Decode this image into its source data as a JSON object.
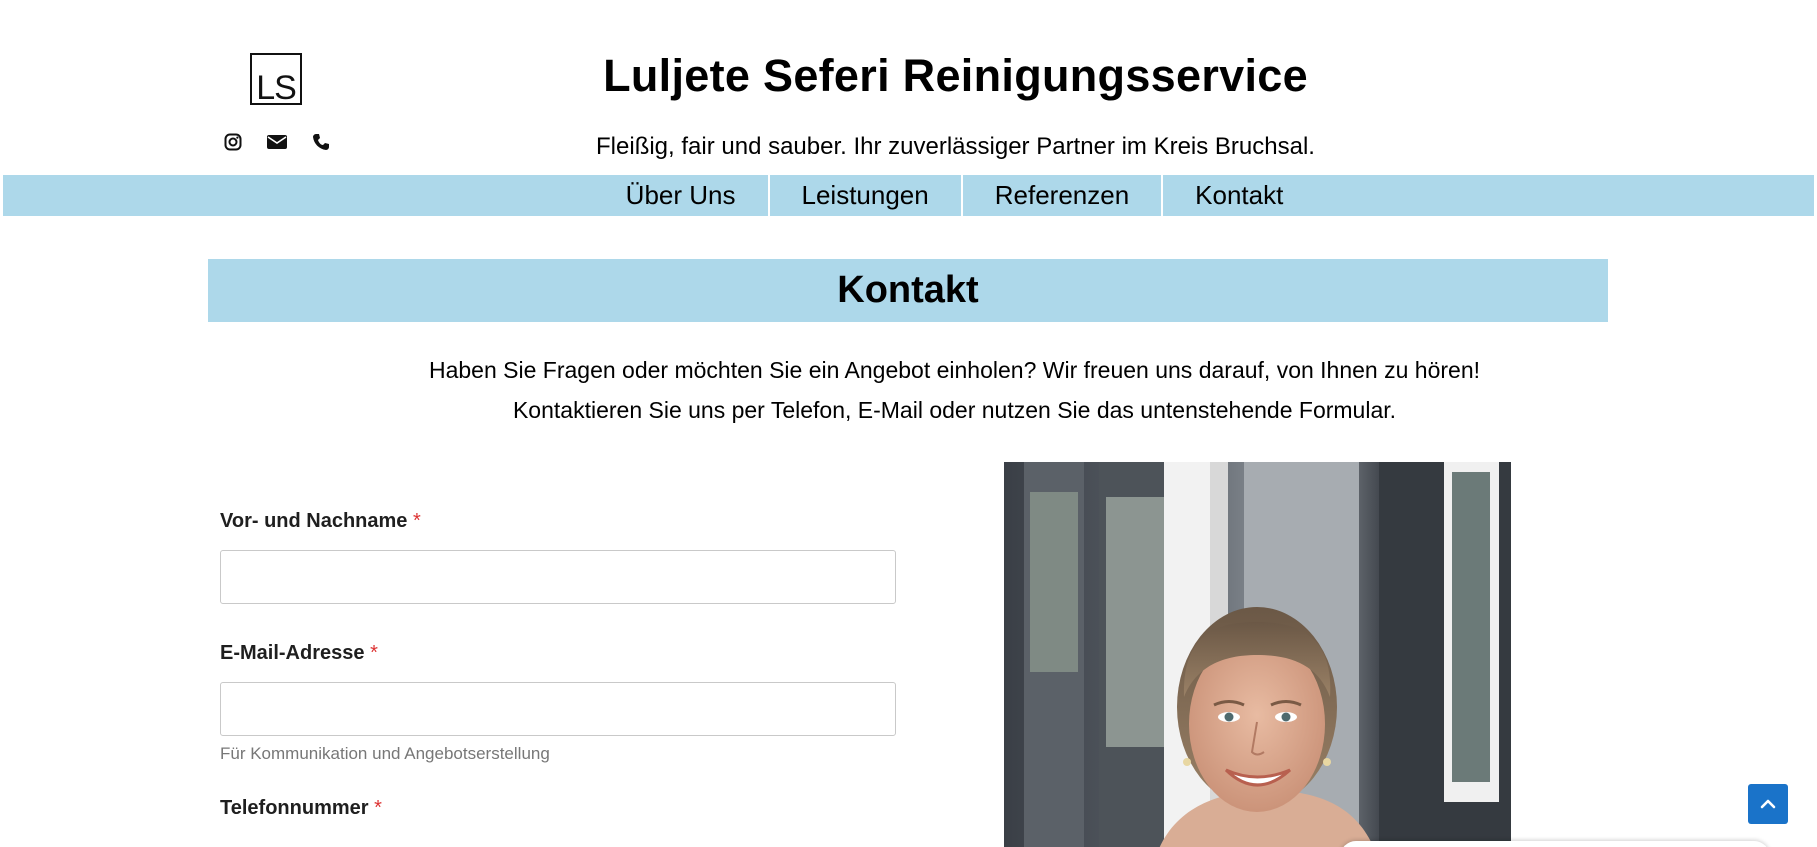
{
  "header": {
    "logo_text": "LS",
    "title": "Luljete Seferi Reinigungsservice",
    "tagline": "Fleißig, fair und sauber. Ihr zuverlässiger Partner im Kreis Bruchsal.",
    "social_icons": [
      "instagram-icon",
      "envelope-icon",
      "phone-icon"
    ]
  },
  "nav": {
    "items": [
      {
        "label": "Über Uns"
      },
      {
        "label": "Leistungen"
      },
      {
        "label": "Referenzen"
      },
      {
        "label": "Kontakt"
      }
    ]
  },
  "contact": {
    "heading": "Kontakt",
    "intro_line1": "Haben Sie Fragen oder möchten Sie ein Angebot einholen? Wir freuen uns darauf, von Ihnen zu hören!",
    "intro_line2": "Kontaktieren Sie uns per Telefon, E-Mail oder nutzen Sie das untenstehende Formular."
  },
  "form": {
    "name": {
      "label": "Vor- und Nachname",
      "required_mark": "*",
      "value": ""
    },
    "email": {
      "label": "E-Mail-Adresse",
      "required_mark": "*",
      "value": "",
      "hint": "Für Kommunikation und Angebotserstellung"
    },
    "phone": {
      "label": "Telefonnummer",
      "required_mark": "*"
    }
  },
  "colors": {
    "accent": "#add8ea",
    "required": "#dd3333",
    "scroll_button": "#1a73c9"
  },
  "scroll_top_icon": "chevron-up-icon"
}
